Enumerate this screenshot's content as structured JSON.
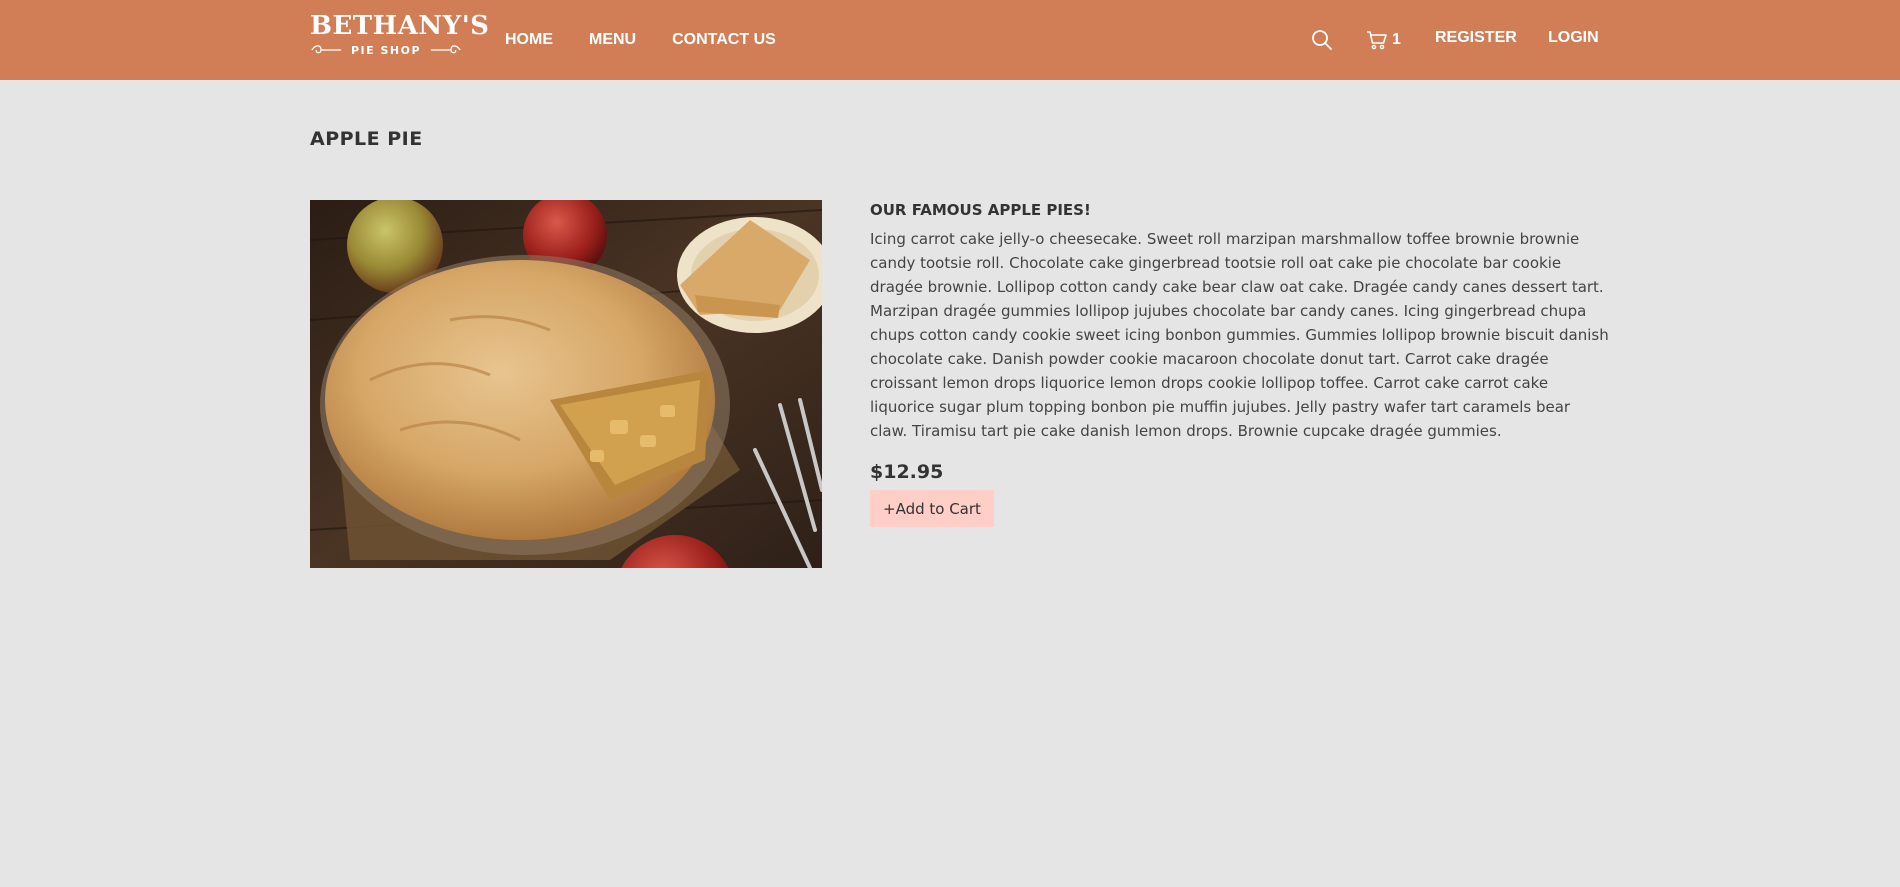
{
  "header": {
    "logo_title": "BETHANY'S",
    "logo_subtitle": "PIE SHOP",
    "nav_links": [
      "HOME",
      "MENU",
      "CONTACT US"
    ],
    "cart_count": "1",
    "register_label": "REGISTER",
    "login_label": "LOGIN",
    "colors": {
      "header_bg": "#d17e57",
      "text": "#ffffff"
    },
    "icons": [
      "search-icon",
      "cart-icon"
    ]
  },
  "product": {
    "title": "APPLE PIE",
    "subtitle": "OUR FAMOUS APPLE PIES!",
    "description": "Icing carrot cake jelly-o cheesecake. Sweet roll marzipan marshmallow toffee brownie brownie candy tootsie roll. Chocolate cake gingerbread tootsie roll oat cake pie chocolate bar cookie dragée brownie. Lollipop cotton candy cake bear claw oat cake. Dragée candy canes dessert tart. Marzipan dragée gummies lollipop jujubes chocolate bar candy canes. Icing gingerbread chupa chups cotton candy cookie sweet icing bonbon gummies. Gummies lollipop brownie biscuit danish chocolate cake. Danish powder cookie macaroon chocolate donut tart. Carrot cake dragée croissant lemon drops liquorice lemon drops cookie lollipop toffee. Carrot cake carrot cake liquorice sugar plum topping bonbon pie muffin jujubes. Jelly pastry wafer tart caramels bear claw. Tiramisu tart pie cake danish lemon drops. Brownie cupcake dragée gummies.",
    "price": "$12.95",
    "add_to_cart_label": "+Add to Cart",
    "colors": {
      "page_bg": "#e5e5e5",
      "button_bg": "#ffcec6"
    }
  }
}
